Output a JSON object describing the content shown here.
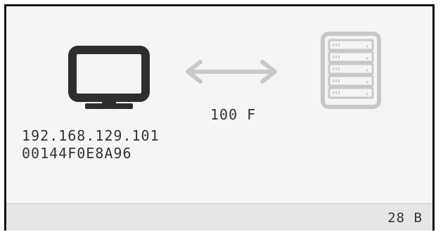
{
  "device": {
    "icon": "monitor-icon",
    "ip": "192.168.129.101",
    "mac": "00144F0E8A96"
  },
  "link": {
    "icon": "bidirectional-arrow-icon",
    "speed": "100 F"
  },
  "server": {
    "icon": "server-rack-icon"
  },
  "status": {
    "value": "28 B"
  },
  "colors": {
    "icon_dark": "#2e2e2e",
    "icon_light": "#c8c8c8",
    "panel_bg": "#f5f5f5",
    "status_bg": "#e6e6e6"
  }
}
